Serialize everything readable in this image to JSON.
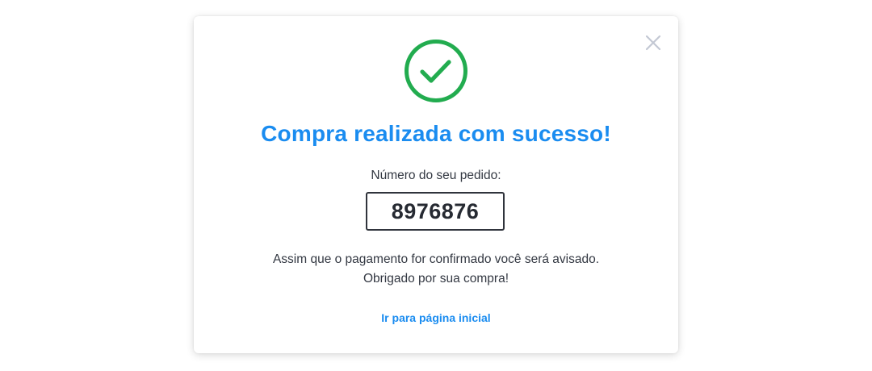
{
  "modal": {
    "close_icon": "close-icon",
    "success_icon": "check-circle-icon",
    "title": "Compra realizada com sucesso!",
    "order_label": "Número do seu pedido:",
    "order_number": "8976876",
    "message_line1": "Assim que o pagamento for confirmado você será avisado.",
    "message_line2": "Obrigado por sua compra!",
    "home_link": "Ir para página inicial"
  },
  "colors": {
    "accent_blue": "#1a8cf0",
    "success_green": "#22ac4f",
    "close_gray": "#c3c8d4",
    "text_dark": "#333842"
  }
}
